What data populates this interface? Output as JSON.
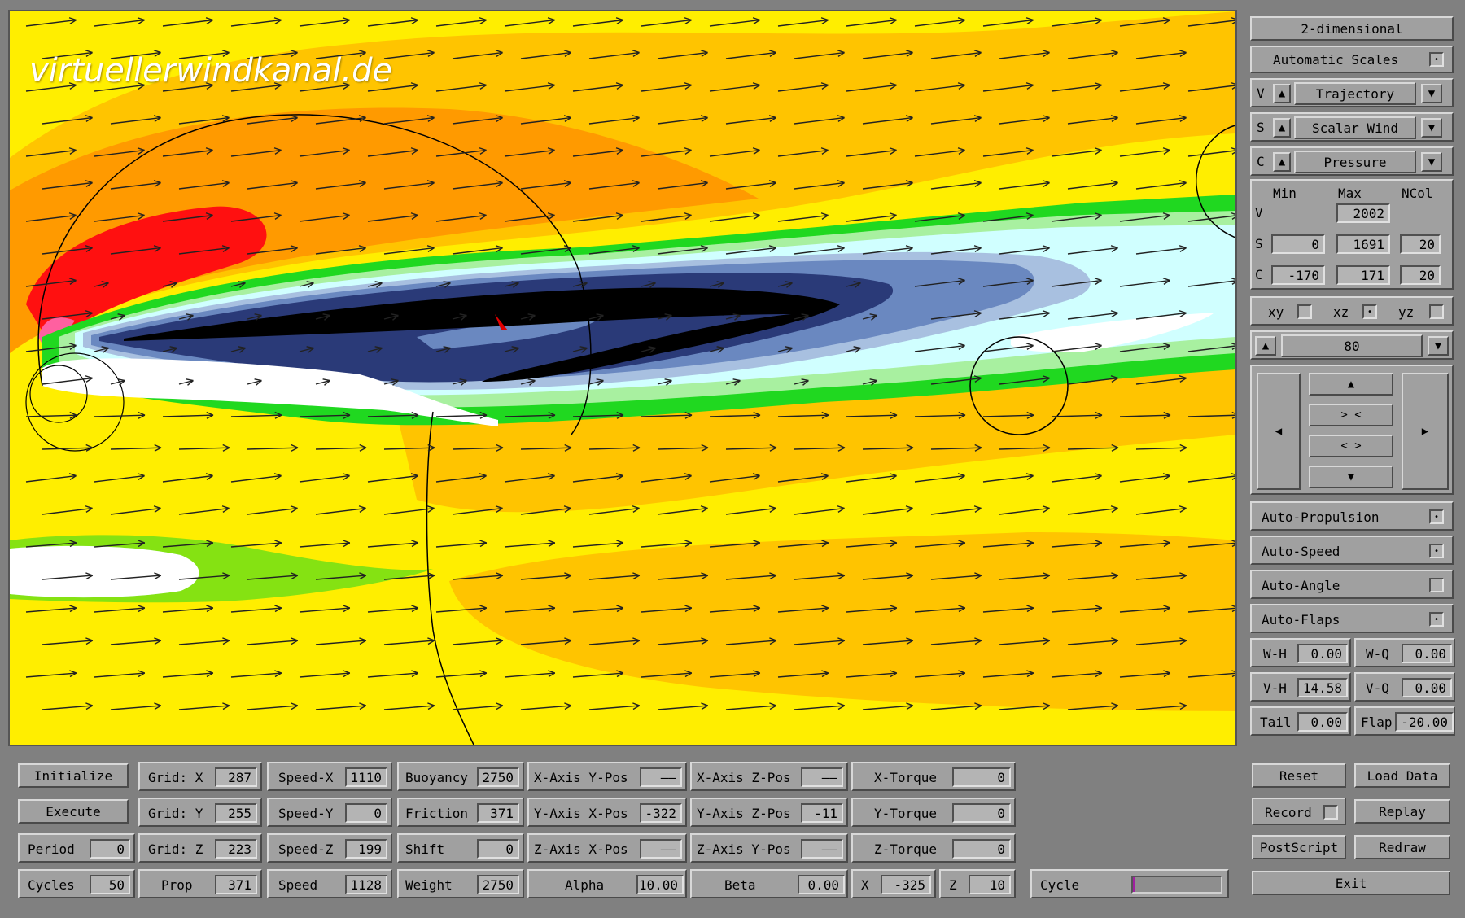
{
  "watermark": "virtuellerwindkanal.de",
  "right": {
    "mode": "2-dimensional",
    "auto_scales": "Automatic Scales",
    "v_label": "V",
    "v_select": "Trajectory",
    "s_label": "S",
    "s_select": "Scalar Wind",
    "c_label": "C",
    "c_select": "Pressure",
    "head_min": "Min",
    "head_max": "Max",
    "head_ncol": "NCol",
    "v_max": "2002",
    "s_min": "0",
    "s_max": "1691",
    "s_ncol": "20",
    "c_min": "-170",
    "c_max": "171",
    "c_ncol": "20",
    "plane_xy": "xy",
    "plane_xz": "xz",
    "plane_yz": "yz",
    "slice_value": "80",
    "nav_up": "▲",
    "nav_zoom_in": "> <",
    "nav_zoom_out": "< >",
    "nav_down": "▼",
    "nav_left": "◀",
    "nav_right": "▶",
    "auto_propulsion": "Auto-Propulsion",
    "auto_speed": "Auto-Speed",
    "auto_angle": "Auto-Angle",
    "auto_flaps": "Auto-Flaps",
    "wh_label": "W-H",
    "wh_value": "0.00",
    "wq_label": "W-Q",
    "wq_value": "0.00",
    "vh_label": "V-H",
    "vh_value": "14.58",
    "vq_label": "V-Q",
    "vq_value": "0.00",
    "tail_label": "Tail",
    "tail_value": "0.00",
    "flap_label": "Flap",
    "flap_value": "-20.00"
  },
  "bottom": {
    "initialize": "Initialize",
    "execute": "Execute",
    "period_label": "Period",
    "period_value": "0",
    "cycles_label": "Cycles",
    "cycles_value": "50",
    "gridx_label": "Grid: X",
    "gridx_value": "287",
    "gridy_label": "Grid: Y",
    "gridy_value": "255",
    "gridz_label": "Grid: Z",
    "gridz_value": "223",
    "prop_label": "Prop",
    "prop_value": "371",
    "speedx_label": "Speed-X",
    "speedx_value": "1110",
    "speedy_label": "Speed-Y",
    "speedy_value": "0",
    "speedz_label": "Speed-Z",
    "speedz_value": "199",
    "speed_label": "Speed",
    "speed_value": "1128",
    "buoyancy_label": "Buoyancy",
    "buoyancy_value": "2750",
    "friction_label": "Friction",
    "friction_value": "371",
    "shift_label": "Shift",
    "shift_value": "0",
    "weight_label": "Weight",
    "weight_value": "2750",
    "xaxis_ypos_label": "X-Axis Y-Pos",
    "xaxis_ypos_value": "——",
    "yaxis_xpos_label": "Y-Axis X-Pos",
    "yaxis_xpos_value": "-322",
    "zaxis_xpos_label": "Z-Axis X-Pos",
    "zaxis_xpos_value": "——",
    "alpha_label": "Alpha",
    "alpha_value": "10.00",
    "xaxis_zpos_label": "X-Axis Z-Pos",
    "xaxis_zpos_value": "——",
    "yaxis_zpos_label": "Y-Axis Z-Pos",
    "yaxis_zpos_value": "-11",
    "zaxis_ypos_label": "Z-Axis Y-Pos",
    "zaxis_ypos_value": "——",
    "beta_label": "Beta",
    "beta_value": "0.00",
    "xtorque_label": "X-Torque",
    "xtorque_value": "0",
    "ytorque_label": "Y-Torque",
    "ytorque_value": "0",
    "ztorque_label": "Z-Torque",
    "ztorque_value": "0",
    "x_label": "X",
    "x_value": "-325",
    "z_label": "Z",
    "z_value": "10",
    "cycle_label": "Cycle",
    "cycle_progress": 0.02
  },
  "actions": {
    "reset": "Reset",
    "load_data": "Load Data",
    "record": "Record",
    "replay": "Replay",
    "postscript": "PostScript",
    "redraw": "Redraw",
    "exit": "Exit"
  },
  "colors": {
    "background": "#ffff00",
    "orange": "#ffb000",
    "red": "#ff0000",
    "green": "#00d000",
    "navy": "#2a3a78",
    "black": "#000000",
    "progress": "#a020a0"
  }
}
